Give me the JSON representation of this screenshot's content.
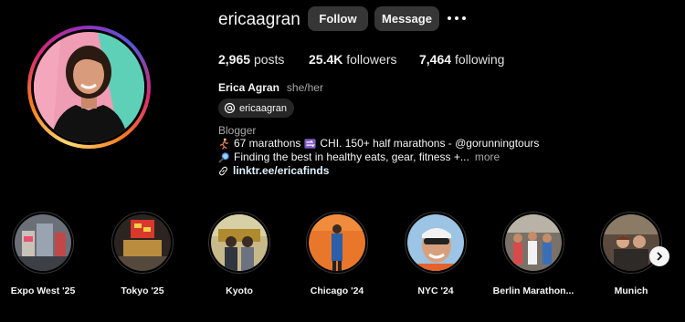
{
  "profile": {
    "username": "ericaagran",
    "follow_label": "Follow",
    "message_label": "Message",
    "more_icon": "ellipsis-icon",
    "stats": {
      "posts_count": "2,965",
      "posts_label": "posts",
      "followers_count": "25.4K",
      "followers_label": "followers",
      "following_count": "7,464",
      "following_label": "following"
    },
    "full_name": "Erica Agran",
    "pronouns": "she/her",
    "threads_handle": "ericaagran",
    "category": "Blogger",
    "bio_line_1": "67 marathons",
    "bio_line_1b": "CHI. 150+ half marathons - @gorunningtours",
    "bio_line_2": "Finding the best in healthy eats, gear, fitness +...",
    "bio_more": "more",
    "link": "linktr.ee/ericafinds"
  },
  "highlights": [
    {
      "label": "Expo West '25"
    },
    {
      "label": "Tokyo '25"
    },
    {
      "label": "Kyoto"
    },
    {
      "label": "Chicago '24"
    },
    {
      "label": "NYC '24"
    },
    {
      "label": "Berlin Marathon..."
    },
    {
      "label": "Munich"
    }
  ],
  "colors": {
    "background": "#000000",
    "button": "#363636",
    "secondary_text": "#a8a8a8",
    "link": "#e0f1ff"
  }
}
